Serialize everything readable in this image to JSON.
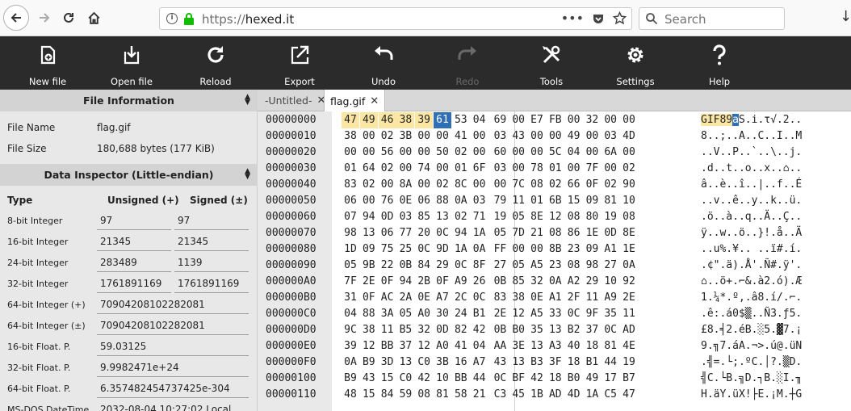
{
  "browser": {
    "url_scheme": "https://",
    "url_host": "hexed.it",
    "search_placeholder": "Search"
  },
  "toolbar": [
    {
      "label": "New file",
      "icon": "new-file-icon"
    },
    {
      "label": "Open file",
      "icon": "open-file-icon"
    },
    {
      "label": "Reload",
      "icon": "reload-icon"
    },
    {
      "label": "Export",
      "icon": "export-icon"
    },
    {
      "label": "Undo",
      "icon": "undo-icon"
    },
    {
      "label": "Redo",
      "icon": "redo-icon",
      "disabled": true
    },
    {
      "label": "Tools",
      "icon": "tools-icon"
    },
    {
      "label": "Settings",
      "icon": "gear-icon"
    },
    {
      "label": "Help",
      "icon": "help-icon"
    }
  ],
  "file_info": {
    "title": "File Information",
    "name_label": "File Name",
    "name_value": "flag.gif",
    "size_label": "File Size",
    "size_value": "180,688 bytes (177 KiB)"
  },
  "inspector": {
    "title": "Data Inspector (Little-endian)",
    "col_type": "Type",
    "col_unsigned": "Unsigned (+)",
    "col_signed": "Signed (±)",
    "rows": [
      {
        "label": "8-bit Integer",
        "unsigned": "97",
        "signed": "97"
      },
      {
        "label": "16-bit Integer",
        "unsigned": "21345",
        "signed": "21345"
      },
      {
        "label": "24-bit Integer",
        "unsigned": "283489",
        "signed": "1139"
      },
      {
        "label": "32-bit Integer",
        "unsigned": "1761891169",
        "signed": "1761891169"
      },
      {
        "label": "64-bit Integer (+)",
        "value": "70904208102282081"
      },
      {
        "label": "64-bit Integer (±)",
        "value": "70904208102282081"
      },
      {
        "label": "16-bit Float. P.",
        "value": "59.03125"
      },
      {
        "label": "32-bit Float. P.",
        "value": "9.9982471e+24"
      },
      {
        "label": "64-bit Float. P.",
        "value": "6.357482454737425e-304"
      },
      {
        "label": "MS-DOS DateTime",
        "value": "2032-08-04 10:27:02 Local"
      }
    ]
  },
  "tabs": [
    {
      "label": "-Untitled-"
    },
    {
      "label": "flag.gif",
      "active": true
    }
  ],
  "hex": {
    "rows": [
      {
        "addr": "00000000",
        "bytes": [
          "47",
          "49",
          "46",
          "38",
          "39",
          "61",
          "53",
          "04",
          "69",
          "00",
          "E7",
          "FB",
          "00",
          "32",
          "00",
          "00"
        ],
        "ascii": "GIF89aS.i.τ√.2.."
      },
      {
        "addr": "00000010",
        "bytes": [
          "38",
          "00",
          "02",
          "3B",
          "00",
          "00",
          "41",
          "00",
          "03",
          "43",
          "00",
          "00",
          "49",
          "00",
          "03",
          "4D"
        ],
        "ascii": "8..;..A..C..I..M"
      },
      {
        "addr": "00000020",
        "bytes": [
          "00",
          "00",
          "56",
          "00",
          "00",
          "50",
          "02",
          "00",
          "60",
          "00",
          "00",
          "5C",
          "04",
          "00",
          "6A",
          "00"
        ],
        "ascii": "..V..P..`..\\..j."
      },
      {
        "addr": "00000030",
        "bytes": [
          "01",
          "64",
          "02",
          "00",
          "74",
          "00",
          "01",
          "6F",
          "03",
          "00",
          "78",
          "01",
          "00",
          "7F",
          "00",
          "02"
        ],
        "ascii": ".d..t..o..x..⌂.."
      },
      {
        "addr": "00000040",
        "bytes": [
          "83",
          "02",
          "00",
          "8A",
          "00",
          "02",
          "8C",
          "00",
          "00",
          "7C",
          "08",
          "02",
          "66",
          "0F",
          "02",
          "90"
        ],
        "ascii": "â..è..î..|..f..É"
      },
      {
        "addr": "00000050",
        "bytes": [
          "06",
          "00",
          "76",
          "0E",
          "06",
          "88",
          "0A",
          "03",
          "79",
          "11",
          "01",
          "6B",
          "15",
          "09",
          "81",
          "10"
        ],
        "ascii": "..v..ê..y..k..ü."
      },
      {
        "addr": "00000060",
        "bytes": [
          "07",
          "94",
          "0D",
          "03",
          "85",
          "13",
          "02",
          "71",
          "19",
          "05",
          "8E",
          "12",
          "08",
          "80",
          "19",
          "08"
        ],
        "ascii": ".ö..à..q..Ä..Ç.."
      },
      {
        "addr": "00000070",
        "bytes": [
          "98",
          "13",
          "06",
          "77",
          "20",
          "0C",
          "94",
          "1A",
          "05",
          "7D",
          "21",
          "08",
          "86",
          "1E",
          "0D",
          "8E"
        ],
        "ascii": "ÿ..w..ö..}!.å..Ä"
      },
      {
        "addr": "00000080",
        "bytes": [
          "1D",
          "09",
          "75",
          "25",
          "0C",
          "9D",
          "1A",
          "0A",
          "FF",
          "00",
          "00",
          "8B",
          "23",
          "09",
          "A1",
          "1E"
        ],
        "ascii": "..u%.¥.. ..ï#.í."
      },
      {
        "addr": "00000090",
        "bytes": [
          "05",
          "9B",
          "22",
          "0B",
          "84",
          "29",
          "0C",
          "8F",
          "27",
          "05",
          "A5",
          "23",
          "08",
          "98",
          "27",
          "0A"
        ],
        "ascii": ".¢\".ä).Å'.Ñ#.ÿ'."
      },
      {
        "addr": "000000A0",
        "bytes": [
          "7F",
          "2E",
          "0F",
          "94",
          "2B",
          "0F",
          "A9",
          "26",
          "0B",
          "85",
          "32",
          "0A",
          "A2",
          "29",
          "10",
          "92"
        ],
        "ascii": "⌂..ö+.⌐&.à2.ó).Æ"
      },
      {
        "addr": "000000B0",
        "bytes": [
          "31",
          "0F",
          "AC",
          "2A",
          "0E",
          "A7",
          "2C",
          "0C",
          "83",
          "38",
          "0E",
          "A1",
          "2F",
          "11",
          "A9",
          "2E"
        ],
        "ascii": "1.¼*.º,.â8.í/.⌐."
      },
      {
        "addr": "000000C0",
        "bytes": [
          "04",
          "88",
          "3A",
          "05",
          "A0",
          "30",
          "24",
          "B1",
          "2E",
          "12",
          "A5",
          "33",
          "0C",
          "9F",
          "35",
          "11"
        ],
        "ascii": ".ê:.á0$▒..Ñ3.ƒ5."
      },
      {
        "addr": "000000D0",
        "bytes": [
          "9C",
          "38",
          "11",
          "B5",
          "32",
          "0D",
          "82",
          "42",
          "0B",
          "B0",
          "35",
          "13",
          "B2",
          "37",
          "0C",
          "AD"
        ],
        "ascii": "£8.╡2.éB.░5.▓7.¡"
      },
      {
        "addr": "000000E0",
        "bytes": [
          "39",
          "12",
          "BB",
          "37",
          "12",
          "A0",
          "41",
          "04",
          "AA",
          "3E",
          "13",
          "A3",
          "40",
          "18",
          "81",
          "4E"
        ],
        "ascii": "9.╗7.áA.¬>.ú@.üN"
      },
      {
        "addr": "000000F0",
        "bytes": [
          "0A",
          "B9",
          "3D",
          "13",
          "C0",
          "3B",
          "16",
          "A7",
          "43",
          "13",
          "B3",
          "3F",
          "18",
          "B1",
          "44",
          "19"
        ],
        "ascii": ".╣=.└;.ºC.│?.▒D."
      },
      {
        "addr": "00000100",
        "bytes": [
          "B9",
          "43",
          "15",
          "C0",
          "42",
          "10",
          "BB",
          "44",
          "0C",
          "BF",
          "42",
          "18",
          "B0",
          "49",
          "17",
          "B7"
        ],
        "ascii": "╣C.└B.╗D.┐B.░I.╖"
      },
      {
        "addr": "00000110",
        "bytes": [
          "48",
          "15",
          "84",
          "59",
          "08",
          "81",
          "58",
          "21",
          "C3",
          "45",
          "1B",
          "AD",
          "4D",
          "1A",
          "C5",
          "47"
        ],
        "ascii": "H.äY.üX!├E.¡M.┼G"
      }
    ]
  }
}
